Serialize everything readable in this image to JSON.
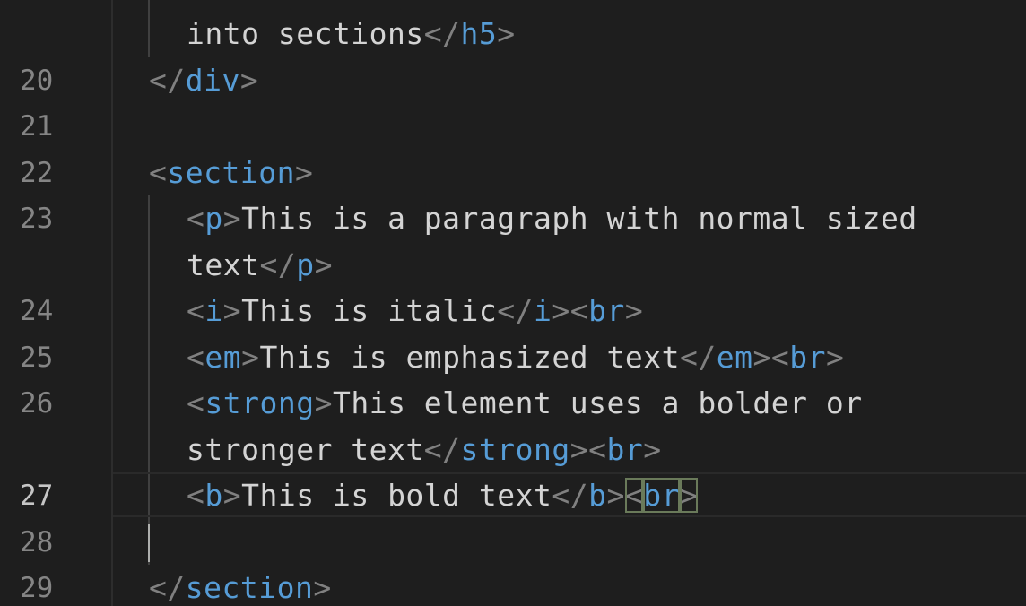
{
  "editor": {
    "lines": [
      {
        "num": "",
        "parts": [
          [
            "x",
            "into sections"
          ],
          [
            "p",
            "</"
          ],
          [
            "t",
            "h5"
          ],
          [
            "p",
            ">"
          ]
        ]
      },
      {
        "num": "20",
        "parts": [
          [
            "p",
            "</"
          ],
          [
            "t",
            "div"
          ],
          [
            "p",
            ">"
          ]
        ]
      },
      {
        "num": "21",
        "parts": []
      },
      {
        "num": "22",
        "parts": [
          [
            "p",
            "<"
          ],
          [
            "t",
            "section"
          ],
          [
            "p",
            ">"
          ]
        ]
      },
      {
        "num": "23",
        "parts": [
          [
            "p",
            "<"
          ],
          [
            "t",
            "p"
          ],
          [
            "p",
            ">"
          ],
          [
            "x",
            "This is a paragraph with normal sized"
          ]
        ]
      },
      {
        "num": "",
        "parts": [
          [
            "x",
            "text"
          ],
          [
            "p",
            "</"
          ],
          [
            "t",
            "p"
          ],
          [
            "p",
            ">"
          ]
        ]
      },
      {
        "num": "24",
        "parts": [
          [
            "p",
            "<"
          ],
          [
            "t",
            "i"
          ],
          [
            "p",
            ">"
          ],
          [
            "x",
            "This is italic"
          ],
          [
            "p",
            "</"
          ],
          [
            "t",
            "i"
          ],
          [
            "p",
            "><"
          ],
          [
            "t",
            "br"
          ],
          [
            "p",
            ">"
          ]
        ]
      },
      {
        "num": "25",
        "parts": [
          [
            "p",
            "<"
          ],
          [
            "t",
            "em"
          ],
          [
            "p",
            ">"
          ],
          [
            "x",
            "This is emphasized text"
          ],
          [
            "p",
            "</"
          ],
          [
            "t",
            "em"
          ],
          [
            "p",
            "><"
          ],
          [
            "t",
            "br"
          ],
          [
            "p",
            ">"
          ]
        ]
      },
      {
        "num": "26",
        "parts": [
          [
            "p",
            "<"
          ],
          [
            "t",
            "strong"
          ],
          [
            "p",
            ">"
          ],
          [
            "x",
            "This element uses a bolder or"
          ]
        ]
      },
      {
        "num": "",
        "parts": [
          [
            "x",
            "stronger text"
          ],
          [
            "p",
            "</"
          ],
          [
            "t",
            "strong"
          ],
          [
            "p",
            "><"
          ],
          [
            "t",
            "br"
          ],
          [
            "p",
            ">"
          ]
        ]
      },
      {
        "num": "27",
        "active": true,
        "parts": [
          [
            "p",
            "<"
          ],
          [
            "t",
            "b"
          ],
          [
            "p",
            ">"
          ],
          [
            "x",
            "This is bold text"
          ],
          [
            "p",
            "</"
          ],
          [
            "t",
            "b"
          ],
          [
            "p",
            ">"
          ],
          [
            "pm",
            "<"
          ],
          [
            "tm",
            "br"
          ],
          [
            "pm",
            ">"
          ]
        ]
      },
      {
        "num": "28",
        "parts": []
      },
      {
        "num": "29",
        "parts": [
          [
            "p",
            "</"
          ],
          [
            "t",
            "section"
          ],
          [
            "p",
            ">"
          ]
        ]
      }
    ]
  },
  "colors": {
    "background": "#1e1e1e",
    "line_number": "#858585",
    "tag": "#569cd6",
    "punctuation": "#808080",
    "text": "#d4d4d4"
  }
}
